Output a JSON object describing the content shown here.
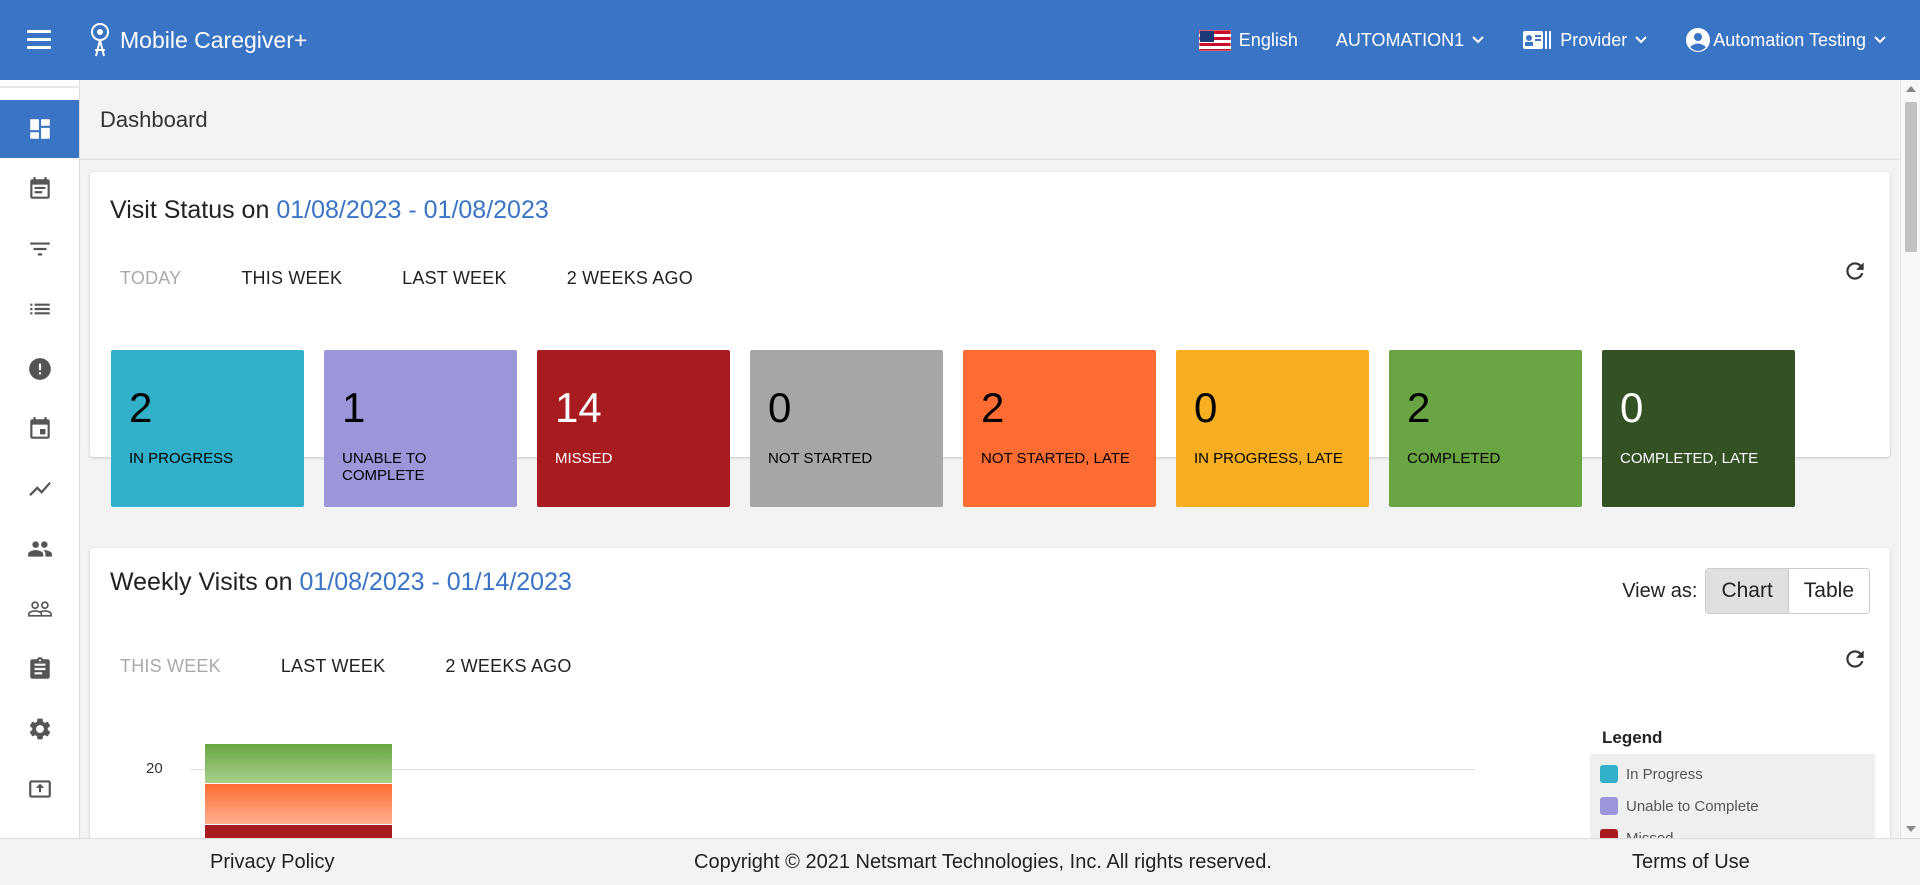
{
  "header": {
    "brand": "Mobile Caregiver+",
    "language": "English",
    "agency": "AUTOMATION1",
    "role": "Provider",
    "user": "Automation Testing"
  },
  "sidebar": {
    "items": [
      {
        "icon": "dashboard-icon",
        "active": true
      },
      {
        "icon": "calendar-note-icon"
      },
      {
        "icon": "filter-icon"
      },
      {
        "icon": "list-icon"
      },
      {
        "icon": "alert-icon"
      },
      {
        "icon": "calendar-icon"
      },
      {
        "icon": "trend-icon"
      },
      {
        "icon": "people-icon"
      },
      {
        "icon": "people-outline-icon"
      },
      {
        "icon": "clipboard-icon"
      },
      {
        "icon": "gear-icon"
      },
      {
        "icon": "upload-icon"
      }
    ]
  },
  "page": {
    "title": "Dashboard"
  },
  "visit_status": {
    "title_prefix": "Visit Status on",
    "date_range": "01/08/2023 - 01/08/2023",
    "tabs": [
      "TODAY",
      "THIS WEEK",
      "LAST WEEK",
      "2 WEEKS AGO"
    ],
    "tiles": [
      {
        "count": "2",
        "label": "IN PROGRESS",
        "color": "#33b0c9"
      },
      {
        "count": "1",
        "label": "UNABLE TO COMPLETE",
        "color": "#9b96da"
      },
      {
        "count": "14",
        "label": "MISSED",
        "color": "#a81c1f"
      },
      {
        "count": "0",
        "label": "NOT STARTED",
        "color": "#a6a6a6"
      },
      {
        "count": "2",
        "label": "NOT STARTED, LATE",
        "color": "#fe6c33"
      },
      {
        "count": "0",
        "label": "IN PROGRESS, LATE",
        "color": "#f8ae21"
      },
      {
        "count": "2",
        "label": "COMPLETED",
        "color": "#69a542"
      },
      {
        "count": "0",
        "label": "COMPLETED, LATE",
        "color": "#335123"
      }
    ]
  },
  "weekly_visits": {
    "title_prefix": "Weekly Visits on",
    "date_range": "01/08/2023 - 01/14/2023",
    "view_as_label": "View as:",
    "view_chart": "Chart",
    "view_table": "Table",
    "tabs": [
      "THIS WEEK",
      "LAST WEEK",
      "2 WEEKS AGO"
    ],
    "legend_title": "Legend",
    "legend": [
      {
        "label": "In Progress",
        "color": "#33b0c9"
      },
      {
        "label": "Unable to Complete",
        "color": "#9b96da"
      },
      {
        "label": "Missed",
        "color": "#a81c1f"
      }
    ]
  },
  "chart_data": {
    "type": "bar",
    "stacked": true,
    "yticks_visible": [
      "20"
    ],
    "series_visible_top_to_bottom": [
      {
        "name": "Completed",
        "color": "#69a542"
      },
      {
        "name": "Not Started, Late",
        "color": "#fe6c33"
      },
      {
        "name": "Missed",
        "color": "#a81c1f"
      }
    ]
  },
  "footer": {
    "privacy": "Privacy Policy",
    "copyright": "Copyright © 2021 Netsmart Technologies, Inc. All rights reserved.",
    "terms": "Terms of Use"
  }
}
